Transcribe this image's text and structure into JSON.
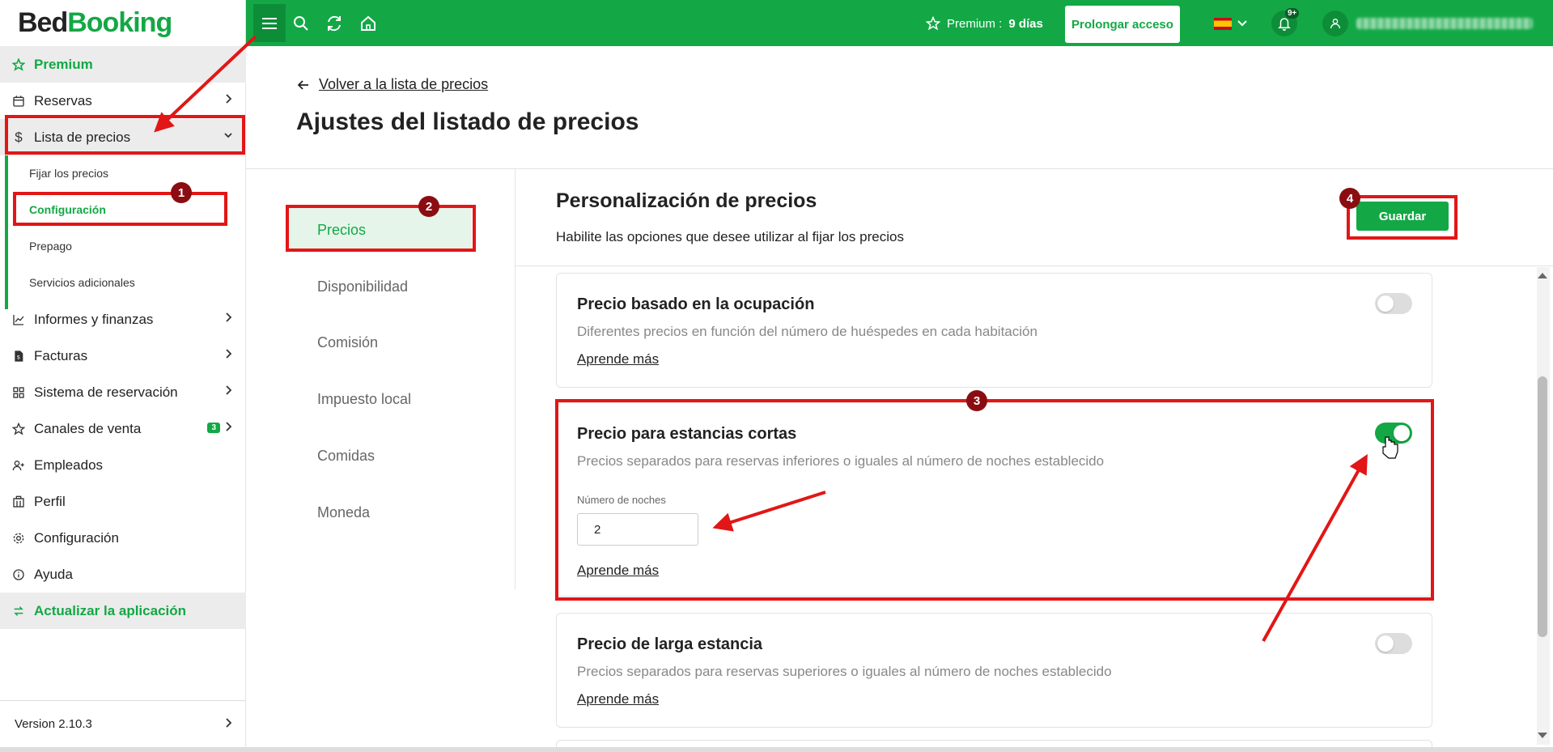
{
  "app": {
    "logo_part1": "Bed",
    "logo_part2": "Booking"
  },
  "topbar": {
    "premium_label": "Premium :",
    "premium_days": "9 días",
    "prolong_label": "Prolongar acceso",
    "notifications_badge": "9+"
  },
  "sidebar": {
    "premium": "Premium",
    "reservas": "Reservas",
    "lista_precios": "Lista de precios",
    "sub_items": [
      "Fijar los precios",
      "Configuración",
      "Prepago",
      "Servicios adicionales"
    ],
    "informes": "Informes y finanzas",
    "facturas": "Facturas",
    "sistema": "Sistema de reservación",
    "canales": "Canales de venta",
    "canales_badge": "3",
    "empleados": "Empleados",
    "perfil": "Perfil",
    "configuracion": "Configuración",
    "ayuda": "Ayuda",
    "actualizar": "Actualizar la aplicación",
    "version": "Version 2.10.3"
  },
  "main": {
    "back_link": "Volver a la lista de precios",
    "page_title": "Ajustes del listado de precios",
    "tabs": [
      "Precios",
      "Disponibilidad",
      "Comisión",
      "Impuesto local",
      "Comidas",
      "Moneda"
    ],
    "section_title": "Personalización de precios",
    "section_subtitle": "Habilite las opciones que desee utilizar al fijar los precios",
    "save_label": "Guardar",
    "cards": [
      {
        "title": "Precio basado en la ocupación",
        "desc": "Diferentes precios en función del número de huéspedes en cada habitación",
        "link": "Aprende más",
        "enabled": false
      },
      {
        "title": "Precio para estancias cortas",
        "desc": "Precios separados para reservas inferiores o iguales al número de noches establecido",
        "field_label": "Número de noches",
        "field_value": "2",
        "link": "Aprende más",
        "enabled": true
      },
      {
        "title": "Precio de larga estancia",
        "desc": "Precios separados para reservas superiores o iguales al número de noches establecido",
        "link": "Aprende más",
        "enabled": false
      }
    ]
  },
  "annotations": [
    "1",
    "2",
    "3",
    "4"
  ],
  "colors": {
    "brand": "#13a845",
    "annotation": "#e21616",
    "annotation_badge": "#8b0d12"
  }
}
